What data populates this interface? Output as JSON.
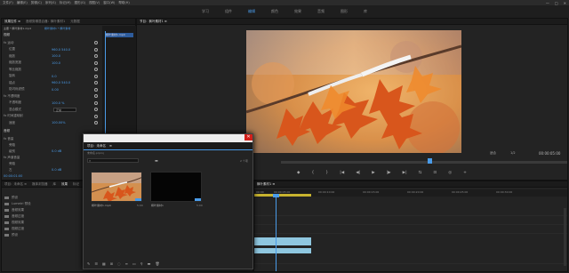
{
  "menu": [
    "文件(F)",
    "编辑(E)",
    "剪辑(C)",
    "序列(S)",
    "标记(M)",
    "图形(G)",
    "视图(V)",
    "窗口(W)",
    "帮助(H)"
  ],
  "window_controls": [
    "—",
    "□",
    "✕"
  ],
  "workspaces": [
    {
      "label": "学习",
      "active": false
    },
    {
      "label": "组件",
      "active": false
    },
    {
      "label": "编辑",
      "active": true
    },
    {
      "label": "颜色",
      "active": false
    },
    {
      "label": "效果",
      "active": false
    },
    {
      "label": "音频",
      "active": false
    },
    {
      "label": "图形",
      "active": false
    },
    {
      "label": "库",
      "active": false
    }
  ],
  "effects_panel": {
    "tabs": [
      "效果控件 ≡",
      "音频剪辑混合器：枫叶素材1",
      "元数据"
    ],
    "source": "主要 * 枫叶素材1.mp4",
    "clip_ref": "枫叶素材1 * 枫叶素材",
    "clip_bar": "枫叶素材1.mp4",
    "section_video": "视频",
    "rows": [
      {
        "label": "fx 运动",
        "value": ""
      },
      {
        "label": "位置",
        "value": "960.0  540.0"
      },
      {
        "label": "缩放",
        "value": "100.0"
      },
      {
        "label": "缩放宽度",
        "value": "100.0"
      },
      {
        "label": "等比缩放",
        "value": ""
      },
      {
        "label": "旋转",
        "value": "0.0"
      },
      {
        "label": "锚点",
        "value": "960.0  540.0"
      },
      {
        "label": "防闪烁滤镜",
        "value": "0.00"
      },
      {
        "label": "fx 不透明度",
        "value": ""
      },
      {
        "label": "不透明度",
        "value": "100.0 %"
      },
      {
        "label": "混合模式",
        "value": "正常"
      },
      {
        "label": "fx 时间重映射",
        "value": ""
      },
      {
        "label": "速度",
        "value": "100.00%"
      }
    ],
    "section_audio": "音频",
    "audio_rows": [
      {
        "label": "fx 音量",
        "value": ""
      },
      {
        "label": "旁路",
        "value": ""
      },
      {
        "label": "级别",
        "value": "0.0 dB"
      },
      {
        "label": "fx 声道音量",
        "value": ""
      },
      {
        "label": "旁路",
        "value": ""
      },
      {
        "label": "左",
        "value": "0.0 dB"
      }
    ],
    "timecode": "00:00:01:00"
  },
  "program_monitor": {
    "tab": "节目：枫叶素材1 ≡",
    "timecode_left": "00:00:01:00",
    "fit": "适合",
    "ratio": "1/2",
    "timecode_right": "00:00:05:00",
    "progress": 0.52,
    "transport": [
      "◆",
      "{",
      "}",
      "|◀",
      "◀|",
      "▶",
      "|▶",
      "▶|",
      "⇆",
      "⊡",
      "◎",
      "+"
    ]
  },
  "project_panel": {
    "tabs": [
      "项目：未命名 ≡",
      "媒体浏览器",
      "库",
      "信息",
      "效果",
      "标记",
      "历史记录"
    ],
    "folders": [
      "Lumetri 预设",
      "音频效果",
      "音频过渡",
      "视频效果",
      "视频过渡",
      "预设"
    ],
    "first_item": "预设"
  },
  "timeline": {
    "tab": "枫叶素材1 ≡",
    "timecode": "00:00:01:00",
    "ruler": [
      "00:00",
      "00:00:05:00",
      "00:00:10:00",
      "00:00:15:00",
      "00:00:20:00",
      "00:00:25:00",
      "00:00:30:00"
    ]
  },
  "media_window": {
    "title": "",
    "tabs": [
      "项目：未命名",
      "≡"
    ],
    "path": "未命名.prproj",
    "count": "2 个项",
    "items": [
      {
        "name": "枫叶素材1.mp4",
        "duration": "5:00"
      },
      {
        "name": "枫叶素材1",
        "duration": "5:00"
      }
    ],
    "bottom_icons": [
      "✎",
      "☰",
      "▦",
      "⊞",
      "◌",
      "≡",
      "▭",
      "⚲",
      "▬",
      "🗑"
    ]
  },
  "colors": {
    "accent": "#4a9be8",
    "timecode": "#d8c34b",
    "clip": "#8fc7e0",
    "close": "#d4201a"
  }
}
